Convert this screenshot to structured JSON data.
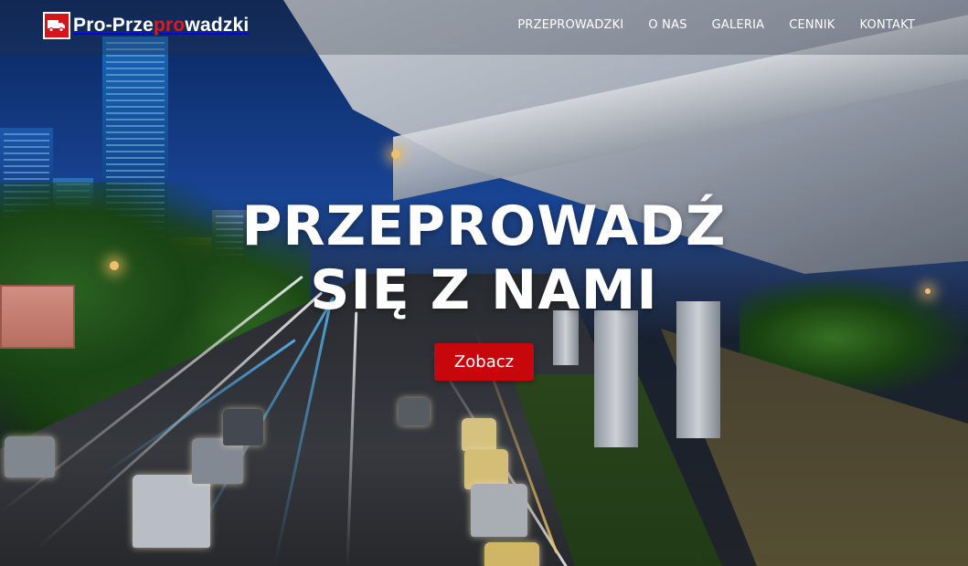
{
  "header": {
    "logo": {
      "part1": "Pro-Prze",
      "part2": "pro",
      "part3": "wadzki"
    },
    "nav": [
      {
        "label": "PRZEPROWADZKI"
      },
      {
        "label": "O NAS"
      },
      {
        "label": "GALERIA"
      },
      {
        "label": "CENNIK"
      },
      {
        "label": "KONTAKT"
      }
    ]
  },
  "hero": {
    "title_line1": "PRZEPROWADŹ",
    "title_line2": "SIĘ Z NAMI",
    "cta_label": "Zobacz"
  },
  "colors": {
    "accent_red": "#c8070d",
    "logo_red": "#e3181f",
    "text": "#ffffff"
  },
  "icons": {
    "logo_icon": "truck-icon"
  }
}
